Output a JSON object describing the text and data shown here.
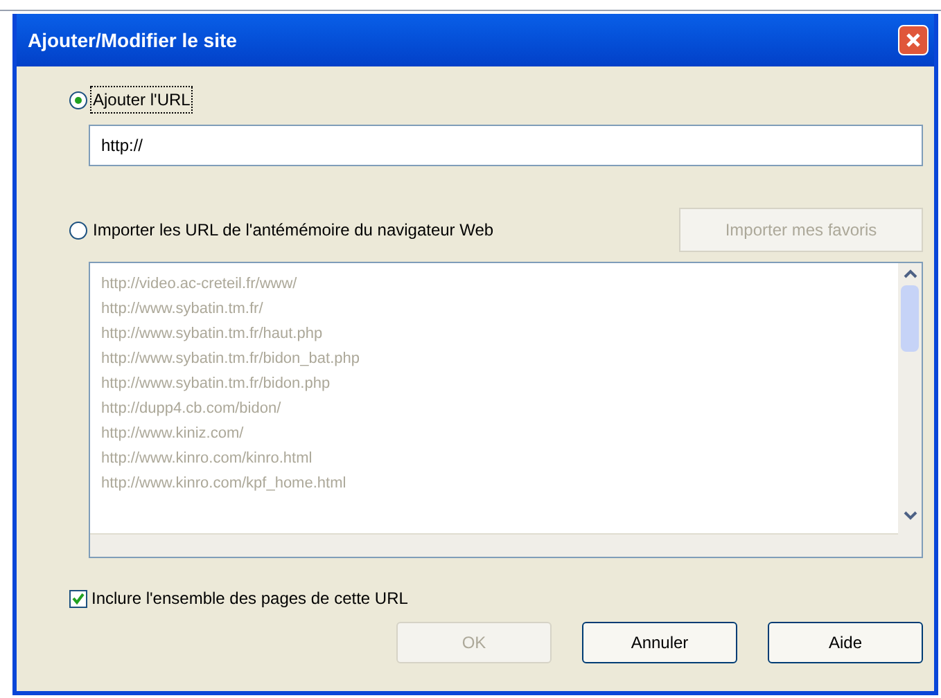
{
  "window": {
    "title": "Ajouter/Modifier le site"
  },
  "options": [
    {
      "label": "Ajouter l'URL",
      "selected": true
    },
    {
      "label": "Importer les URL de l'antémémoire du navigateur Web",
      "selected": false
    }
  ],
  "url_field": {
    "value": "http://"
  },
  "import_button": {
    "label": "Importer mes favoris",
    "disabled": true
  },
  "url_list": {
    "disabled": true,
    "items": [
      "http://video.ac-creteil.fr/www/",
      "http://www.sybatin.tm.fr/",
      "http://www.sybatin.tm.fr/haut.php",
      "http://www.sybatin.tm.fr/bidon_bat.php",
      "http://www.sybatin.tm.fr/bidon.php",
      "http://dupp4.cb.com/bidon/",
      "http://www.kiniz.com/",
      "http://www.kinro.com/kinro.html",
      "http://www.kinro.com/kpf_home.html"
    ]
  },
  "include_all": {
    "label": "Inclure l'ensemble des pages de cette URL",
    "checked": true
  },
  "buttons": [
    {
      "label": "OK",
      "disabled": true
    },
    {
      "label": "Annuler",
      "disabled": false
    },
    {
      "label": "Aide",
      "disabled": false
    }
  ]
}
